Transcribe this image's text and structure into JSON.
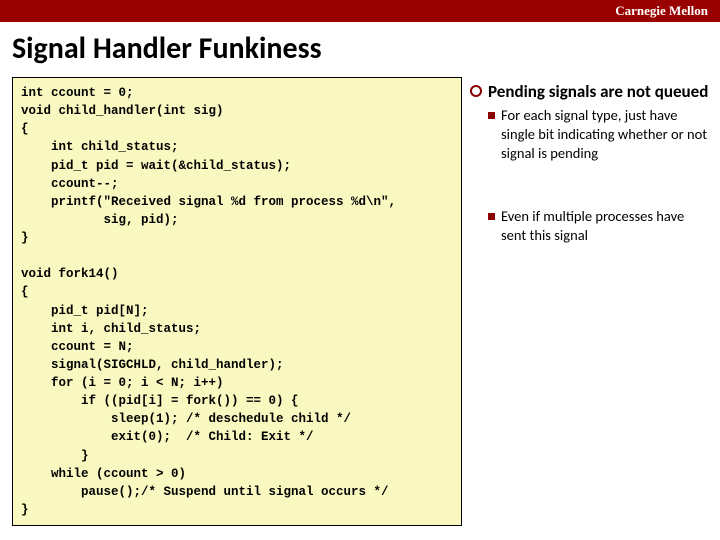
{
  "header": {
    "brand": "Carnegie Mellon"
  },
  "title": "Signal Handler Funkiness",
  "code": "int ccount = 0;\nvoid child_handler(int sig)\n{\n    int child_status;\n    pid_t pid = wait(&child_status);\n    ccount--;\n    printf(\"Received signal %d from process %d\\n\",\n           sig, pid);\n}\n\nvoid fork14()\n{\n    pid_t pid[N];\n    int i, child_status;\n    ccount = N;\n    signal(SIGCHLD, child_handler);\n    for (i = 0; i < N; i++)\n        if ((pid[i] = fork()) == 0) {\n            sleep(1); /* deschedule child */\n            exit(0);  /* Child: Exit */\n        }\n    while (ccount > 0)\n        pause();/* Suspend until signal occurs */\n}",
  "bullets": {
    "main": "Pending signals are not queued",
    "subs": [
      "For each signal type, just have single bit indicating whether or not signal is pending",
      "Even if multiple processes have sent this signal"
    ]
  }
}
